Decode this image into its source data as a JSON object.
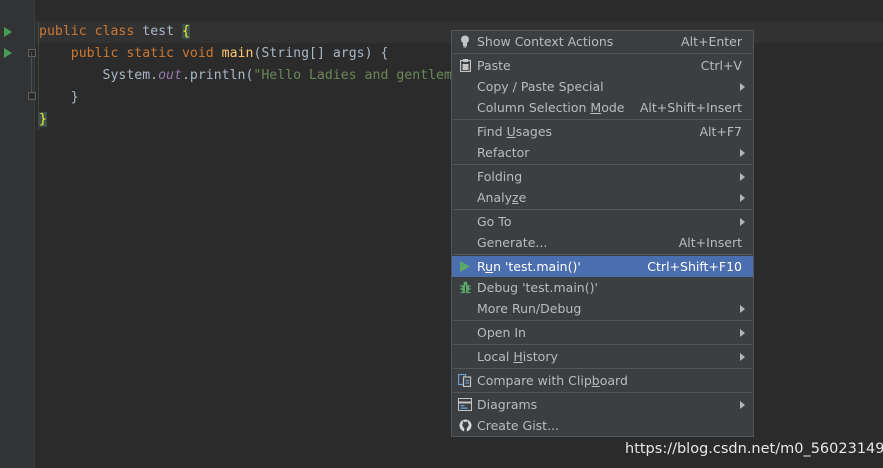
{
  "editor": {
    "line1": {
      "kw1": "public",
      "kw2": "class",
      "name": "test",
      "brace": "{"
    },
    "line2": {
      "kw1": "public",
      "kw2": "static",
      "kw3": "void",
      "method": "main",
      "params": "(String[] args) {"
    },
    "line3": {
      "obj": "System.",
      "field": "out",
      "call": ".println(",
      "string": "\"Hello Ladies and gentlem"
    },
    "line4": {
      "brace": "}"
    },
    "line5": {
      "brace": "}"
    }
  },
  "context_menu": {
    "items": [
      {
        "label": "Show Context Actions",
        "shortcut": "Alt+Enter",
        "icon": "lightbulb-icon"
      },
      {
        "label": "Paste",
        "shortcut": "Ctrl+V",
        "icon": "clipboard-icon"
      },
      {
        "label": "Copy / Paste Special",
        "submenu": true
      },
      {
        "label_pre": "Column Selection ",
        "label_ul": "M",
        "label_post": "ode",
        "shortcut": "Alt+Shift+Insert"
      },
      {
        "label_pre": "Find ",
        "label_ul": "U",
        "label_post": "sages",
        "shortcut": "Alt+F7"
      },
      {
        "label": "Refactor",
        "submenu": true
      },
      {
        "label": "Folding",
        "submenu": true
      },
      {
        "label_pre": "Analy",
        "label_ul": "z",
        "label_post": "e",
        "submenu": true
      },
      {
        "label": "Go To",
        "submenu": true
      },
      {
        "label": "Generate...",
        "shortcut": "Alt+Insert"
      },
      {
        "label_pre": "R",
        "label_ul": "u",
        "label_post": "n 'test.main()'",
        "shortcut": "Ctrl+Shift+F10",
        "icon": "run-icon",
        "selected": true
      },
      {
        "label": "Debug 'test.main()'",
        "icon": "debug-icon"
      },
      {
        "label": "More Run/Debug",
        "submenu": true
      },
      {
        "label": "Open In",
        "submenu": true
      },
      {
        "label_pre": "Local ",
        "label_ul": "H",
        "label_post": "istory",
        "submenu": true
      },
      {
        "label_pre": "Compare with Clip",
        "label_ul": "b",
        "label_post": "oard",
        "icon": "compare-icon"
      },
      {
        "label": "Diagrams",
        "submenu": true,
        "icon": "diagram-icon"
      },
      {
        "label": "Create Gist...",
        "icon": "github-icon"
      }
    ]
  },
  "watermark": "https://blog.csdn.net/m0_56023149",
  "colors": {
    "accent": "#4b6eaf",
    "run_green": "#499c54",
    "menu_bg": "#3c3f41",
    "editor_bg": "#2b2b2b"
  }
}
